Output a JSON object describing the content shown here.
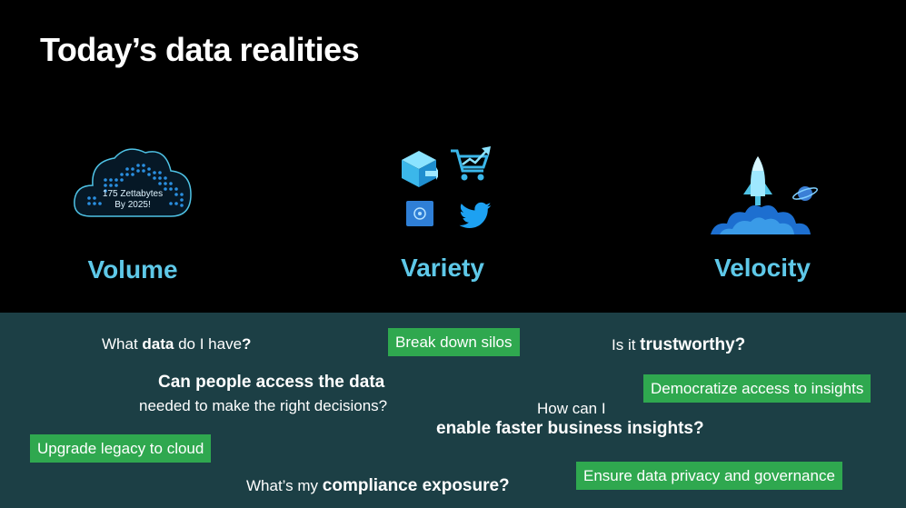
{
  "slide": {
    "title": "Today’s data realities"
  },
  "pillars": {
    "volume": {
      "label": "Volume",
      "badge_line1": "175 Zettabytes",
      "badge_line2": "By 2025!"
    },
    "variety": {
      "label": "Variety"
    },
    "velocity": {
      "label": "Velocity"
    }
  },
  "questions": {
    "data_have": {
      "pre": "What ",
      "bold": "data",
      "mid": " do I have",
      "end": "?"
    },
    "trustworthy": {
      "pre": "Is it ",
      "bold": "trustworthy?"
    },
    "access_line1": "Can people access the data",
    "access_line2": "needed to make the right decisions?",
    "insights_line1": "How can I",
    "insights_line2": "enable faster business insights?",
    "compliance": {
      "pre": "What’s my ",
      "bold": "compliance exposure?"
    }
  },
  "actions": {
    "break_silos": "Break down silos",
    "democratize": "Democratize access to insights",
    "upgrade": "Upgrade legacy to cloud",
    "privacy": "Ensure data privacy and governance"
  },
  "colors": {
    "accent_cyan": "#5ec8e8",
    "pill_green": "#2fa84f",
    "panel_teal": "#1c3f45",
    "icon_blue": "#2f7fd6"
  }
}
